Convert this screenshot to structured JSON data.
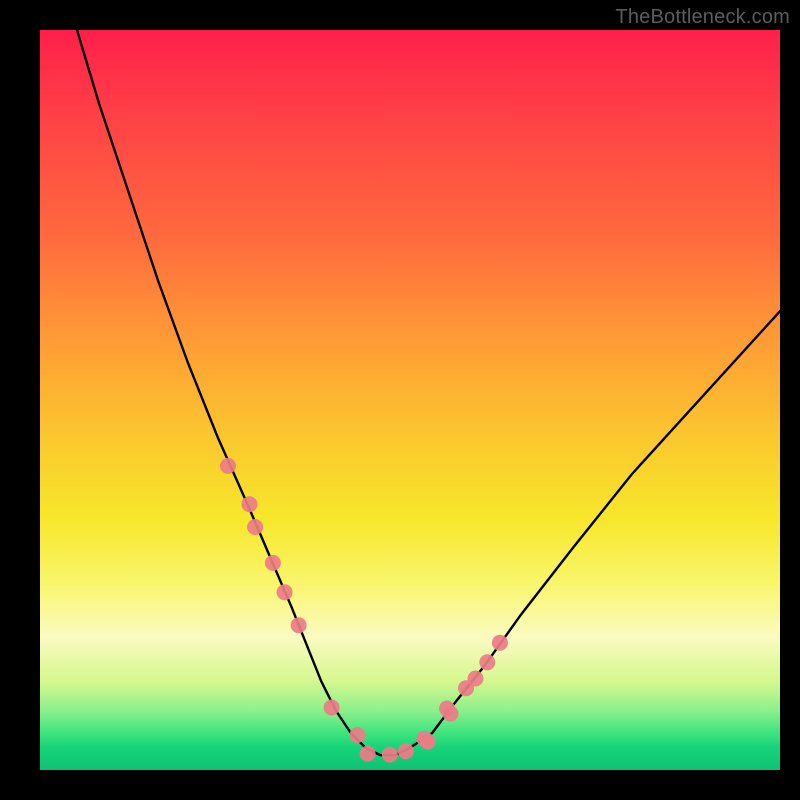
{
  "watermark": "TheBottleneck.com",
  "chart_data": {
    "type": "line",
    "title": "",
    "xlabel": "",
    "ylabel": "",
    "xlim": [
      0,
      100
    ],
    "ylim": [
      0,
      100
    ],
    "grid": false,
    "legend": false,
    "series": [
      {
        "name": "bottleneck-curve",
        "x": [
          5,
          8,
          12,
          16,
          20,
          24,
          28,
          31,
          34,
          36,
          38,
          40,
          42,
          44,
          46,
          48,
          50,
          53,
          56,
          60,
          65,
          72,
          80,
          90,
          100
        ],
        "y": [
          100,
          90,
          78,
          66,
          55,
          45,
          36,
          29,
          22,
          17,
          12,
          8,
          5,
          3,
          2,
          2,
          3,
          5,
          9,
          14,
          21,
          30,
          40,
          51,
          62
        ]
      }
    ],
    "marker_clusters": [
      {
        "name": "left-cluster",
        "x_range": [
          26,
          35
        ],
        "y_range": [
          18,
          36
        ],
        "count": 6,
        "color": "#eb7c87"
      },
      {
        "name": "bottom-cluster",
        "x_range": [
          40,
          52
        ],
        "y_range": [
          2,
          6
        ],
        "count": 6,
        "color": "#eb7c87"
      },
      {
        "name": "right-cluster",
        "x_range": [
          53,
          62
        ],
        "y_range": [
          8,
          30
        ],
        "count": 7,
        "color": "#eb7c87"
      }
    ],
    "background_gradient": {
      "direction": "vertical",
      "stops": [
        {
          "pos": 0.0,
          "color": "#ff1f4a"
        },
        {
          "pos": 0.28,
          "color": "#ff6a3e"
        },
        {
          "pos": 0.55,
          "color": "#fbc72e"
        },
        {
          "pos": 0.75,
          "color": "#f9f66e"
        },
        {
          "pos": 0.88,
          "color": "#d6f78f"
        },
        {
          "pos": 1.0,
          "color": "#0fc272"
        }
      ]
    }
  }
}
